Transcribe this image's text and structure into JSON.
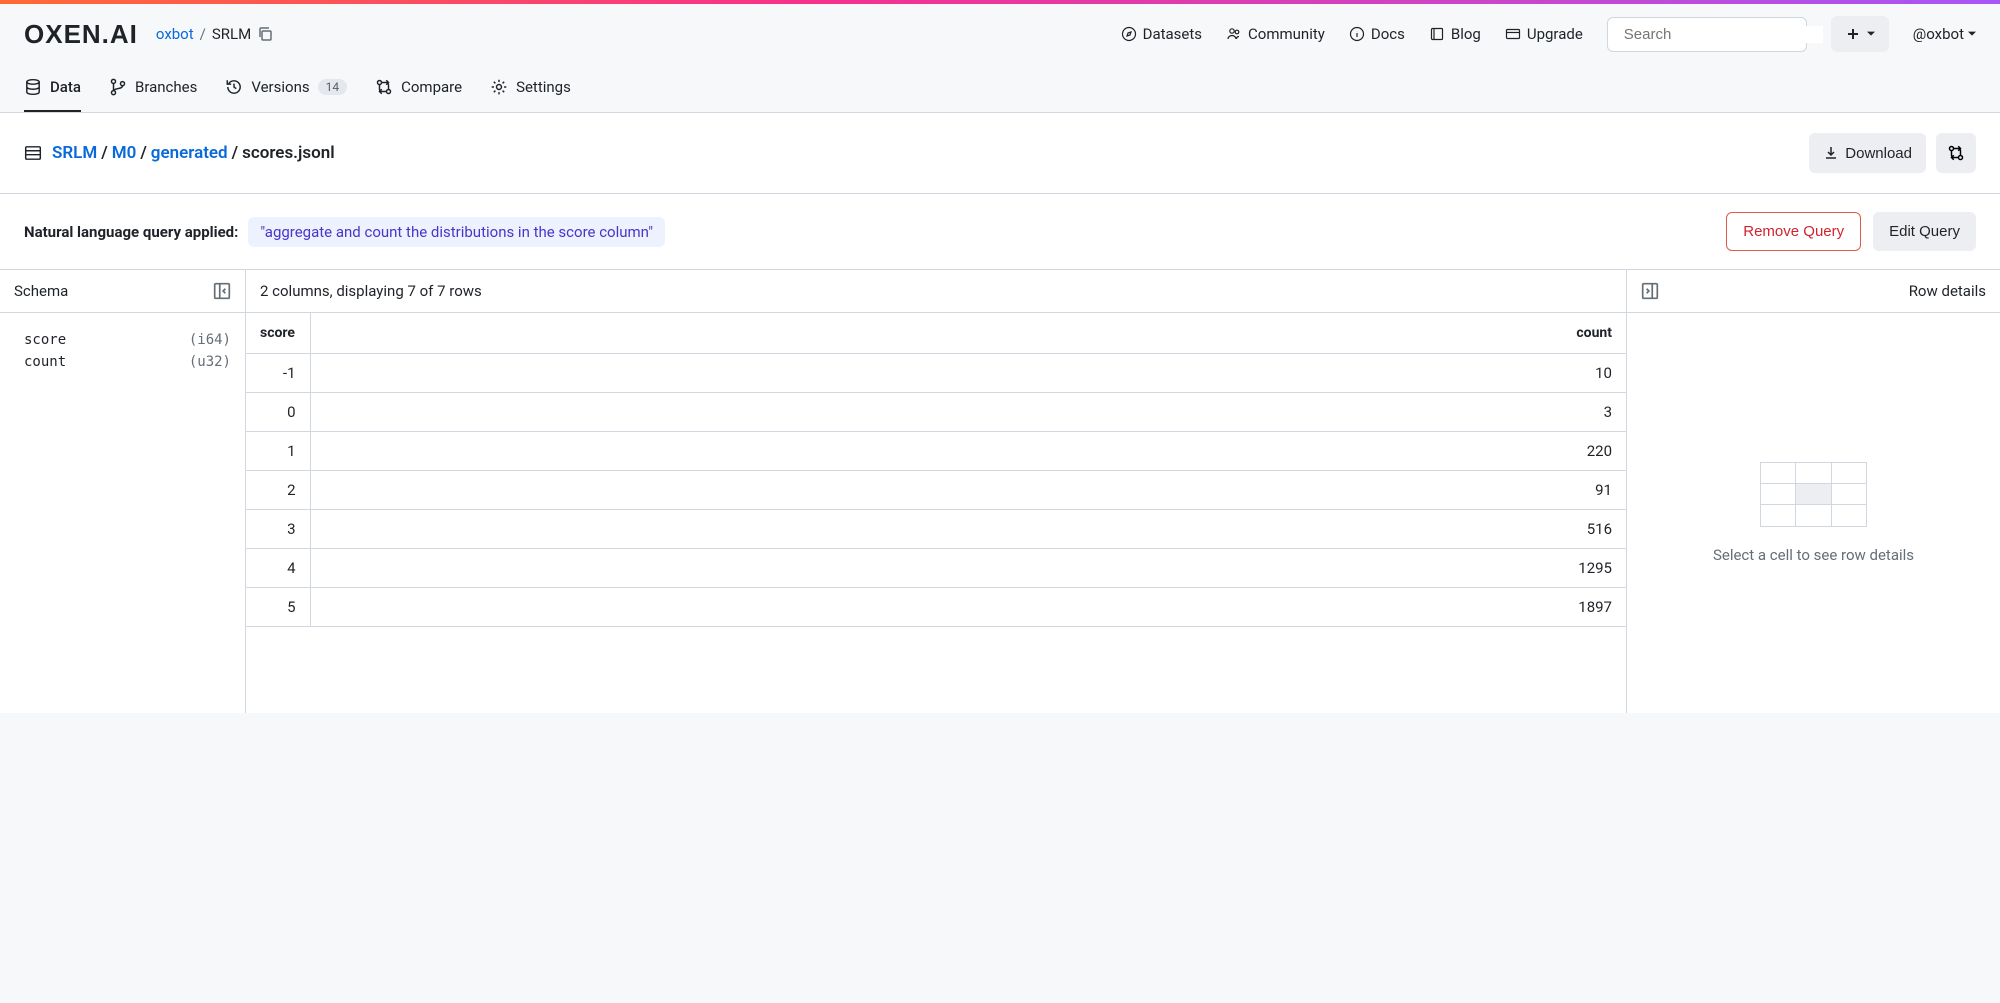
{
  "header": {
    "logo": "OXEN.AI",
    "owner": "oxbot",
    "repo": "SRLM",
    "nav": {
      "datasets": "Datasets",
      "community": "Community",
      "docs": "Docs",
      "blog": "Blog",
      "upgrade": "Upgrade"
    },
    "search_placeholder": "Search",
    "user": "@oxbot"
  },
  "tabs": {
    "data": "Data",
    "branches": "Branches",
    "versions": "Versions",
    "versions_count": "14",
    "compare": "Compare",
    "settings": "Settings"
  },
  "breadcrumb": {
    "parts": [
      "SRLM",
      "M0",
      "generated"
    ],
    "current": "scores.jsonl",
    "download": "Download"
  },
  "query": {
    "label": "Natural language query applied:",
    "text": "\"aggregate and count the distributions in the score column\"",
    "remove": "Remove Query",
    "edit": "Edit Query"
  },
  "schema": {
    "title": "Schema",
    "fields": [
      {
        "name": "score",
        "type": "(i64)"
      },
      {
        "name": "count",
        "type": "(u32)"
      }
    ]
  },
  "table": {
    "summary": "2 columns, displaying 7 of 7 rows",
    "columns": {
      "score": "score",
      "count": "count"
    },
    "rows": [
      {
        "score": "-1",
        "count": "10"
      },
      {
        "score": "0",
        "count": "3"
      },
      {
        "score": "1",
        "count": "220"
      },
      {
        "score": "2",
        "count": "91"
      },
      {
        "score": "3",
        "count": "516"
      },
      {
        "score": "4",
        "count": "1295"
      },
      {
        "score": "5",
        "count": "1897"
      }
    ]
  },
  "details": {
    "title": "Row details",
    "empty": "Select a cell to see row details"
  }
}
